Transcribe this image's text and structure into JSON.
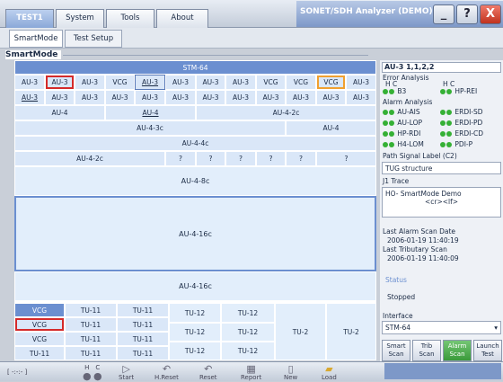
{
  "tabs": [
    "TEST1",
    "System",
    "Tools",
    "About"
  ],
  "window_title": "SONET/SDH Analyzer (DEMO)",
  "window_buttons": {
    "minimize": "_",
    "help": "?",
    "close": "X"
  },
  "subtabs": [
    "SmartMode",
    "Test Setup"
  ],
  "section": "SmartMode",
  "grid": {
    "stm": "STM-64",
    "row1": [
      "AU-3",
      "AU-3",
      "AU-3",
      "VCG",
      "AU-3",
      "AU-3",
      "AU-3",
      "AU-3",
      "VCG",
      "VCG",
      "VCG",
      "AU-3"
    ],
    "row2": [
      "AU-3",
      "AU-3",
      "AU-3",
      "AU-3",
      "AU-3",
      "AU-3",
      "AU-3",
      "AU-3",
      "AU-3",
      "AU-3",
      "AU-3",
      "AU-3"
    ],
    "row3": [
      "AU-4",
      "AU-4",
      "AU-4-2c"
    ],
    "row4": [
      "AU-4-3c",
      "AU-4"
    ],
    "row5": "AU-4-4c",
    "row6": [
      "AU-4-2c",
      "?",
      "?",
      "?",
      "?",
      "?",
      "?"
    ],
    "row7": "AU-4-8c",
    "block1": "AU-4-16c",
    "block2": "AU-4-16c"
  },
  "tu_table": {
    "col_vcg": [
      "VCG",
      "VCG",
      "VCG",
      "TU-11"
    ],
    "col_tu11a": [
      "TU-11",
      "TU-11",
      "TU-11",
      "TU-11"
    ],
    "col_tu11b": [
      "TU-11",
      "TU-11",
      "TU-11",
      "TU-11"
    ],
    "col_tu12a": [
      "TU-12",
      "TU-12",
      "TU-12"
    ],
    "col_tu12b": [
      "TU-12",
      "TU-12",
      "TU-12"
    ],
    "tu2a": "TU-2",
    "tu2b": "TU-2"
  },
  "right_panel": {
    "selected": "AU-3 1,1,2,2",
    "error_analysis": "Error Analysis",
    "h": "H",
    "c": "C",
    "b3": "B3",
    "hp_rei": "HP-REI",
    "alarm_analysis": "Alarm Analysis",
    "alarms": [
      "AU-AIS",
      "ERDI-SD",
      "AU-LOP",
      "ERDI-PD",
      "HP-RDI",
      "ERDI-CD",
      "H4-LOM",
      "PDI-P"
    ],
    "path_signal_label": "Path Signal Label (C2)",
    "psl_value": "TUG structure",
    "j1_trace": "J1 Trace",
    "j1_line1": "HO- SmartMode Demo",
    "j1_line2": "<cr><lf>",
    "last_alarm_label": "Last Alarm Scan Date",
    "last_alarm_value": "2006-01-19 11:40:19",
    "last_trib_label": "Last Tributary Scan",
    "last_trib_value": "2006-01-19 11:40:09",
    "status_label": "Status",
    "status_value": "Stopped",
    "interface_label": "Interface",
    "interface_value": "STM-64",
    "buttons": [
      [
        "Smart",
        "Scan"
      ],
      [
        "Trib",
        "Scan"
      ],
      [
        "Alarm",
        "Scan"
      ],
      [
        "Launch",
        "Test"
      ]
    ]
  },
  "bottom": {
    "indicator": "[ -:-:- ]",
    "h": "H",
    "c": "C",
    "items": [
      "Start",
      "H.Reset",
      "Reset",
      "Report",
      "New",
      "Load"
    ]
  }
}
